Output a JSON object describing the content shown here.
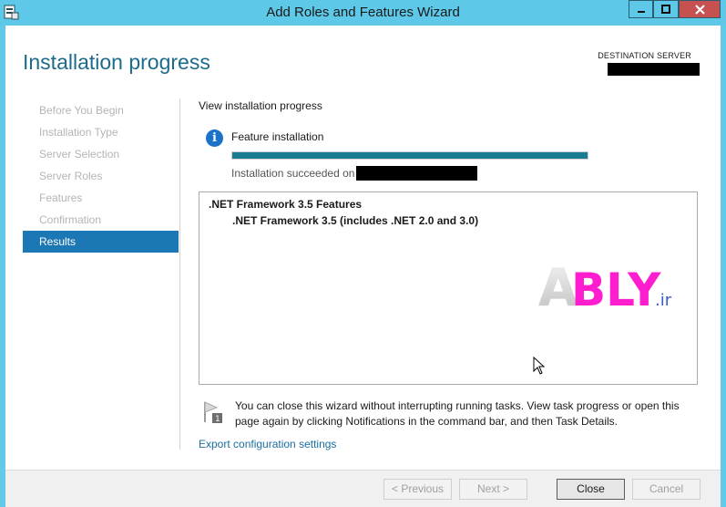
{
  "window": {
    "title": "Add Roles and Features Wizard",
    "accent": "#5ec8e8",
    "close_color": "#c75050",
    "icons": [
      "server-manager-icon",
      "minimize-icon",
      "maximize-icon",
      "close-icon"
    ]
  },
  "header": {
    "title": "Installation progress",
    "destination_label": "DESTINATION SERVER"
  },
  "nav": {
    "items": [
      {
        "label": "Before You Begin",
        "active": false
      },
      {
        "label": "Installation Type",
        "active": false
      },
      {
        "label": "Server Selection",
        "active": false
      },
      {
        "label": "Server Roles",
        "active": false
      },
      {
        "label": "Features",
        "active": false
      },
      {
        "label": "Confirmation",
        "active": false
      },
      {
        "label": "Results",
        "active": true
      }
    ],
    "active_color": "#1c78b4"
  },
  "main": {
    "subheading": "View installation progress",
    "feature_label": "Feature installation",
    "progress_fraction": 1.0,
    "progress_color": "#1a7c93",
    "status_text": "Installation succeeded on",
    "results": [
      ".NET Framework 3.5 Features",
      ".NET Framework 3.5 (includes .NET 2.0 and 3.0)"
    ],
    "watermark": {
      "brand": "ABLY",
      "suffix": ".ir"
    },
    "notice": "You can close this wizard without interrupting running tasks. View task progress or open this page again by clicking Notifications in the command bar, and then Task Details.",
    "export_link": "Export configuration settings"
  },
  "footer": {
    "previous": "< Previous",
    "next": "Next >",
    "close": "Close",
    "cancel": "Cancel"
  }
}
